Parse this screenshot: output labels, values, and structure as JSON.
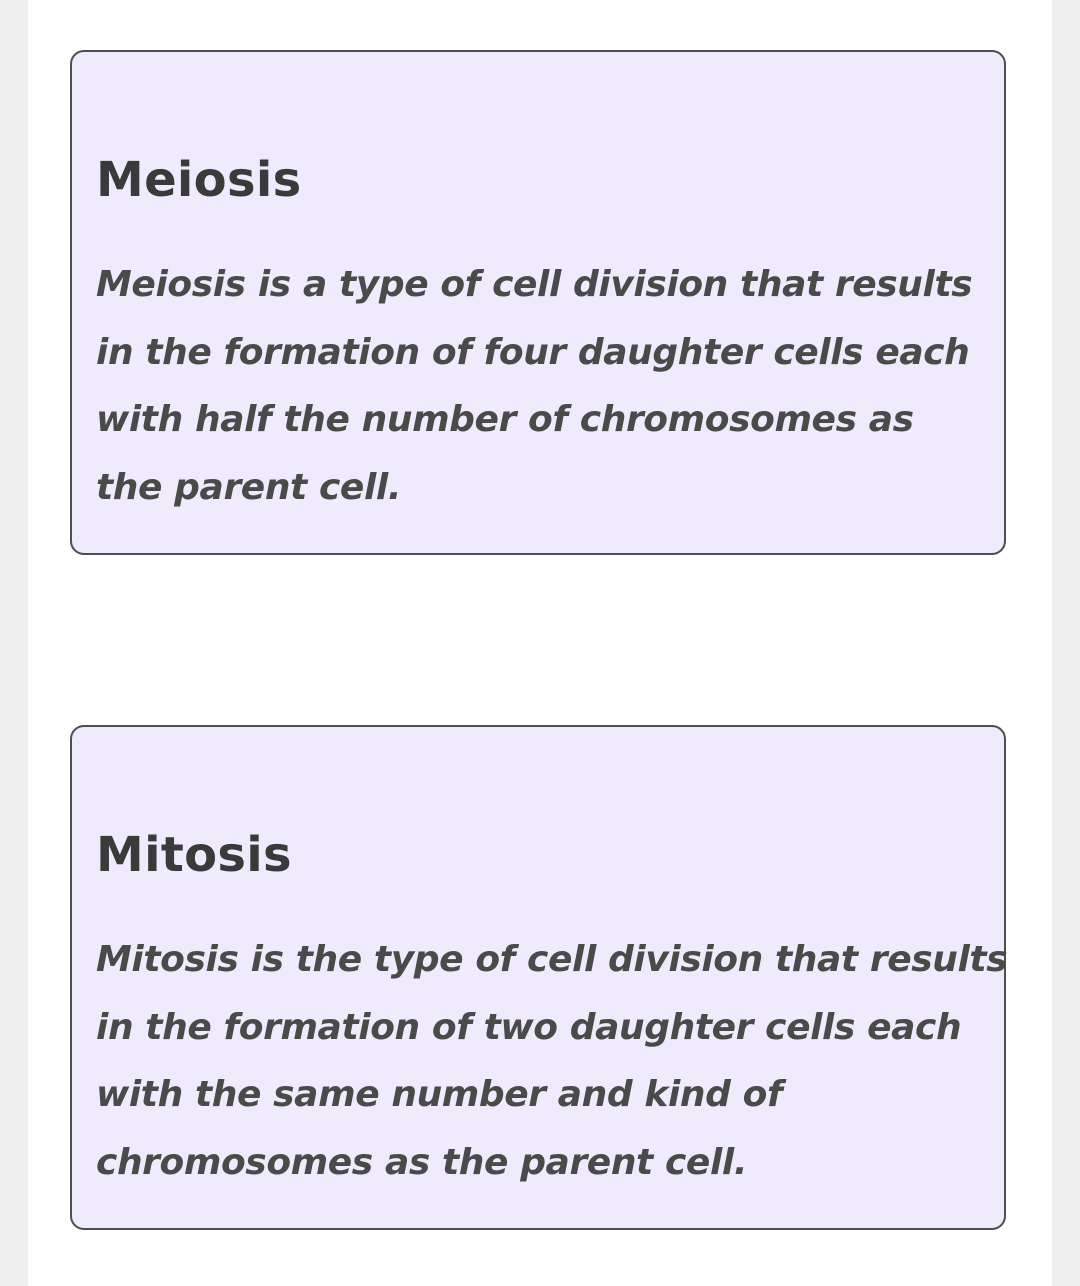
{
  "cards": [
    {
      "title": "Meiosis",
      "lines": [
        "Meiosis is a type of cell division that results",
        "in the formation of four daughter cells each",
        "with half the number of chromosomes as",
        "the parent cell."
      ]
    },
    {
      "title": "Mitosis",
      "lines": [
        "Mitosis is the type of cell division that results",
        "in the formation of two daughter cells each",
        "with the same number and kind of",
        "chromosomes as the parent cell."
      ]
    }
  ],
  "colors": {
    "card_background": "#efebfc",
    "card_border": "#4e4e4e",
    "title_text": "#3a3a3a",
    "body_text": "#4a4a4a",
    "page_background": "#ffffff",
    "outer_background": "#efefef"
  }
}
